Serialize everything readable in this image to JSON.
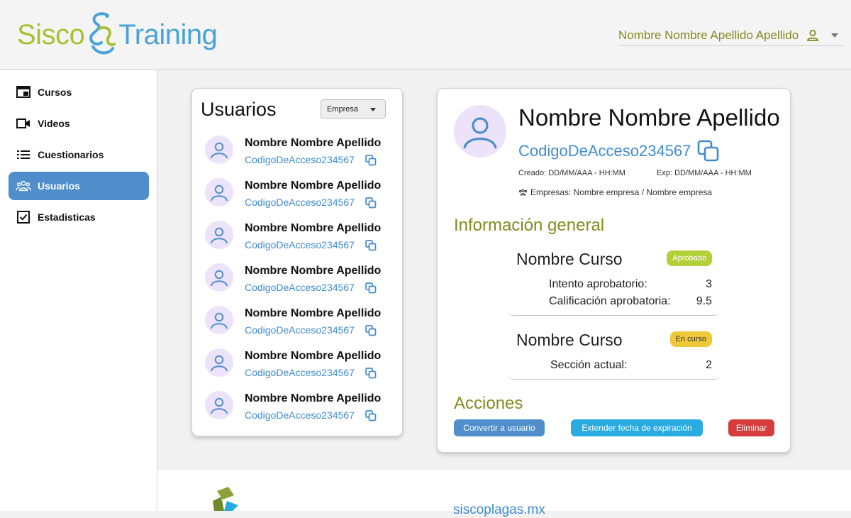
{
  "header": {
    "logo_part1": "Sisco",
    "logo_part2": "Training",
    "user_name": "Nombre Nombre Apellido Apellido"
  },
  "sidebar": {
    "items": [
      {
        "label": "Cursos",
        "icon": "window-icon",
        "active": false
      },
      {
        "label": "Videos",
        "icon": "video-camera-icon",
        "active": false
      },
      {
        "label": "Cuestionarios",
        "icon": "list-icon",
        "active": false
      },
      {
        "label": "Usuarios",
        "icon": "users-group-icon",
        "active": true
      },
      {
        "label": "Estadisticas",
        "icon": "checkbox-icon",
        "active": false
      }
    ]
  },
  "users_panel": {
    "title": "Usuarios",
    "company_filter": "Empresa",
    "users": [
      {
        "name": "Nombre Nombre Apellido",
        "code": "CodigoDeAcceso234567"
      },
      {
        "name": "Nombre Nombre Apellido",
        "code": "CodigoDeAcceso234567"
      },
      {
        "name": "Nombre Nombre Apellido",
        "code": "CodigoDeAcceso234567"
      },
      {
        "name": "Nombre Nombre Apellido",
        "code": "CodigoDeAcceso234567"
      },
      {
        "name": "Nombre Nombre Apellido",
        "code": "CodigoDeAcceso234567"
      },
      {
        "name": "Nombre Nombre Apellido",
        "code": "CodigoDeAcceso234567"
      },
      {
        "name": "Nombre Nombre Apellido",
        "code": "CodigoDeAcceso234567"
      }
    ]
  },
  "detail": {
    "name": "Nombre Nombre Apellido",
    "code": "CodigoDeAcceso234567",
    "created": "Creado: DD/MM/AAA - HH:MM",
    "expires": "Exp: DD/MM/AAA - HH:MM",
    "companies": "Empresas: Nombre empresa / Nombre empresa",
    "general_title": "Información general",
    "courses": [
      {
        "name": "Nombre Curso",
        "status": "Aprobado",
        "stats": [
          {
            "label": "Intento aprobatorio:",
            "value": "3"
          },
          {
            "label": "Calificación aprobatoria:",
            "value": "9.5"
          }
        ]
      },
      {
        "name": "Nombre Curso",
        "status": "En curso",
        "stats": [
          {
            "label": "Sección actual:",
            "value": "2"
          }
        ]
      }
    ],
    "actions_title": "Acciones",
    "actions": {
      "convert": "Convertir a usuario",
      "extend": "Extender fecha de expiración",
      "delete": "Eliminar"
    }
  },
  "footer": {
    "link": "siscoplagas.mx"
  },
  "colors": {
    "accent_blue": "#4f8ecb",
    "olive": "#7f8d1e",
    "link_blue": "#3f8bd0",
    "approved": "#b3cf3a",
    "in_progress": "#efc83a",
    "danger": "#d63c3c",
    "cyan": "#29abe2"
  }
}
